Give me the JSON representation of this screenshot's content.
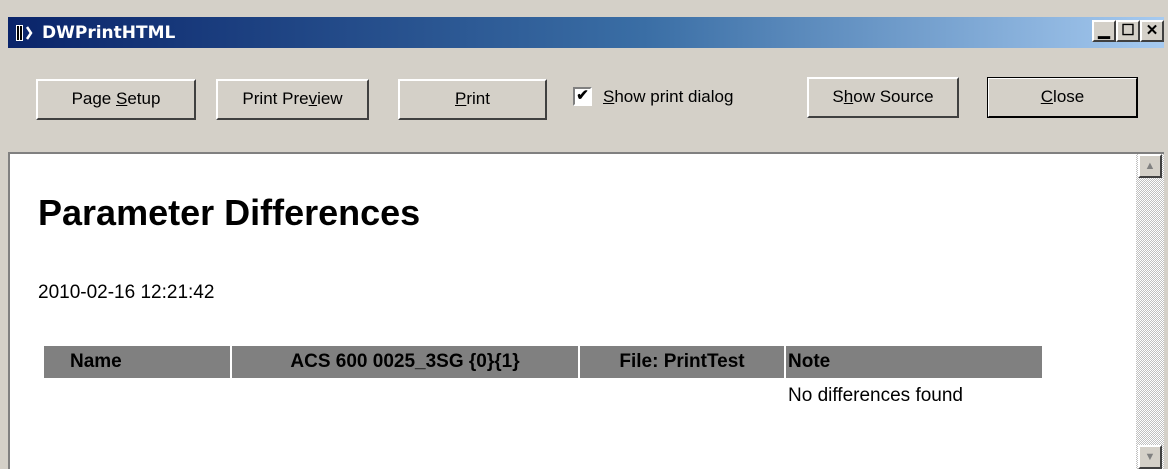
{
  "window": {
    "title": "DWPrintHTML"
  },
  "toolbar": {
    "page_setup": {
      "before": "Page ",
      "mnemonic": "S",
      "after": "etup"
    },
    "print_preview": {
      "before": "Print Pre",
      "mnemonic": "v",
      "after": "iew"
    },
    "print": {
      "before": "",
      "mnemonic": "P",
      "after": "rint"
    },
    "show_print_dialog": {
      "before": "",
      "mnemonic": "S",
      "after": "how print dialog",
      "checked": true
    },
    "show_source": {
      "before": "S",
      "mnemonic": "h",
      "after": "ow Source"
    },
    "close": {
      "before": "",
      "mnemonic": "C",
      "after": "lose"
    }
  },
  "document": {
    "title": "Parameter Differences",
    "timestamp": "2010-02-16 12:21:42",
    "table": {
      "headers": [
        "Name",
        "ACS 600 0025_3SG {0}{1}",
        "File: PrintTest",
        "Note"
      ],
      "rows": [
        [
          "",
          "",
          "",
          "No differences found"
        ]
      ]
    }
  },
  "colors": {
    "title_bar_start": "#0a246a",
    "title_bar_end": "#a6caf0",
    "header_bg": "#808080",
    "face": "#d4d0c8"
  }
}
